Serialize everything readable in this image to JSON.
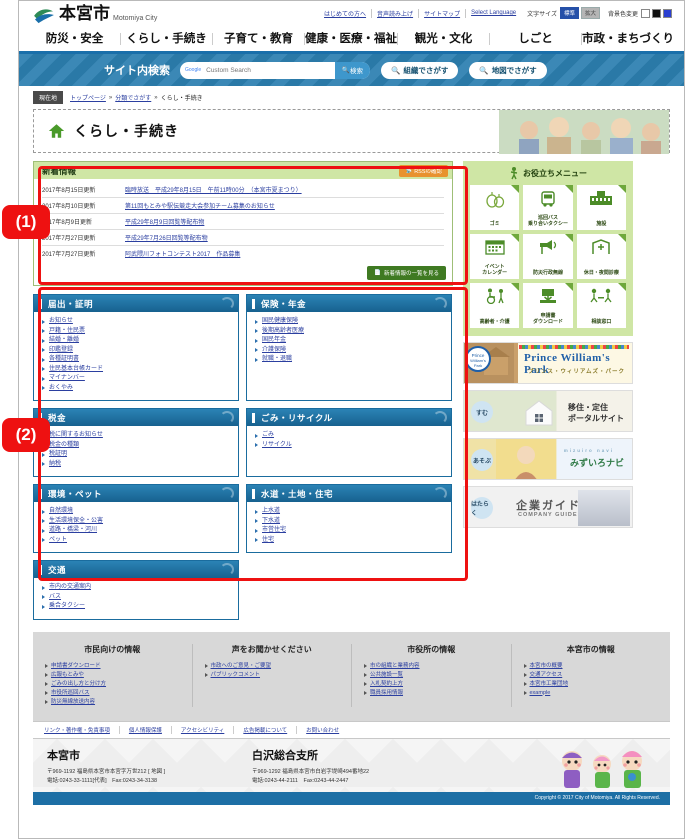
{
  "header": {
    "city_name": "本宮市",
    "city_name_en": "Motomiya City",
    "logo_icon": "swoosh-logo-icon",
    "util_links": [
      "はじめての方へ",
      "音声読み上げ",
      "サイトマップ",
      "Select Language"
    ],
    "text_size_label": "文字サイズ",
    "text_size_options": [
      "標準",
      "拡大"
    ],
    "text_size_selected": "標準",
    "bg_color_label": "背景色変更",
    "bg_color_options": [
      "白",
      "黒",
      "青"
    ],
    "bg_color_selected": "青"
  },
  "gnav": [
    "防災・安全",
    "くらし・手続き",
    "子育て・教育",
    "健康・医療・福祉",
    "観光・文化",
    "しごと",
    "市政・まちづくり"
  ],
  "search": {
    "title": "サイト内検索",
    "engine_badge": "Google",
    "placeholder": "Custom Search",
    "value": "",
    "submit_label": "検索",
    "submit_icon": "search-icon",
    "pills": [
      {
        "label": "組織でさがす",
        "icon": "search-icon"
      },
      {
        "label": "地図でさがす",
        "icon": "search-icon"
      }
    ]
  },
  "breadcrumb": {
    "now_label": "現在地",
    "items": [
      "トップページ",
      "分類でさがす"
    ],
    "current": "くらし・手続き",
    "separator": "»"
  },
  "page_title": {
    "text": "くらし・手続き",
    "icon": "home-icon"
  },
  "news": {
    "heading": "新着情報",
    "rss_label": "RSSの確認",
    "rss_icon": "rss-icon",
    "items": [
      {
        "date": "2017年8月15日更新",
        "title": "臨時放送　平成29年8月15日　午前11時00分　（本宮市夏まつり）"
      },
      {
        "date": "2017年8月10日更新",
        "title": "第11回もとみや駅伝競走大会参加チーム募集のお知らせ"
      },
      {
        "date": "2017年8月9日更新",
        "title": "平成29年8月9日回覧等配布物"
      },
      {
        "date": "2017年7月27日更新",
        "title": "平成29年7月26日回覧等配布物"
      },
      {
        "date": "2017年7月27日更新",
        "title": "阿武隈川フォトコンテスト2017　作品募集"
      }
    ],
    "list_all_label": "新着情報の一覧を見る",
    "list_all_icon": "document-icon"
  },
  "categories": [
    {
      "title": "届出・証明",
      "links": [
        "お知らせ",
        "戸籍・住民票",
        "結婚・離婚",
        "印鑑登録",
        "各種証明書",
        "住民基本台帳カード",
        "マイナンバー",
        "おくやみ"
      ]
    },
    {
      "title": "保険・年金",
      "links": [
        "国民健康保険",
        "後期高齢者医療",
        "国民年金",
        "介護保険",
        "就職・退職"
      ]
    },
    {
      "title": "税金",
      "links": [
        "税に関するお知らせ",
        "税金の種類",
        "税証明",
        "納税"
      ]
    },
    {
      "title": "ごみ・リサイクル",
      "links": [
        "ごみ",
        "リサイクル"
      ]
    },
    {
      "title": "環境・ペット",
      "links": [
        "自然環境",
        "生活環境保全・公害",
        "道路・橋梁・河川",
        "ペット"
      ]
    },
    {
      "title": "水道・土地・住宅",
      "links": [
        "上水道",
        "下水道",
        "市営住宅",
        "住宅"
      ]
    },
    {
      "title": "交通",
      "links": [
        "市内の交通案内",
        "バス",
        "乗合タクシー"
      ]
    }
  ],
  "useful_menu": {
    "title": "お役立ちメニュー",
    "title_icon": "walking-person-icon",
    "tiles": [
      {
        "label": "ゴミ",
        "icon": "garbage-bag-icon"
      },
      {
        "label": "巡回バス\n乗り合いタクシー",
        "icon": "bus-icon"
      },
      {
        "label": "施設",
        "icon": "building-icon"
      },
      {
        "label": "イベント\nカレンダー",
        "icon": "calendar-icon"
      },
      {
        "label": "防災行政無線",
        "icon": "speaker-icon"
      },
      {
        "label": "休日・夜間診療",
        "icon": "hospital-icon"
      },
      {
        "label": "高齢者・介護",
        "icon": "wheelchair-icon"
      },
      {
        "label": "申請書\nダウンロード",
        "icon": "download-icon"
      },
      {
        "label": "相談窓口",
        "icon": "consultation-icon"
      }
    ]
  },
  "banners": [
    {
      "id": "prince-william-park",
      "main": "Prince William's Park",
      "sub": "プリンス・ウィリアムズ・パーク",
      "badge": ""
    },
    {
      "id": "iju-teiju",
      "badge": "すむ",
      "main": "移住・定住\nポータルサイト",
      "sub": ""
    },
    {
      "id": "mizuiro-navi",
      "badge": "あそぶ",
      "main": "みずいろナビ",
      "sub": "mizuiro navi"
    },
    {
      "id": "kigyo-guide",
      "badge": "はたらく",
      "main": "企業ガイド",
      "sub": "COMPANY GUIDE"
    }
  ],
  "footer": {
    "columns": [
      {
        "heading": "市民向けの情報",
        "links": [
          "申請書ダウンロード",
          "広報もとみや",
          "ごみの出し方と分け方",
          "市役所巡回バス",
          "防災無線放送内容"
        ]
      },
      {
        "heading": "声をお聞かせください",
        "links": [
          "市政へのご意見・ご要望",
          "パブリックコメント"
        ]
      },
      {
        "heading": "市役所の情報",
        "links": [
          "市の組織と業務内容",
          "公共施設一覧",
          "入札契約上方",
          "職員採用情報"
        ]
      },
      {
        "heading": "本宮市の情報",
        "links": [
          "本宮市の概要",
          "交通アクセス",
          "本宮市工業団地",
          "example"
        ]
      }
    ],
    "policy_links": [
      "リンク・著作権・免責事項",
      "個人情報保護",
      "アクセシビリティ",
      "広告掲載について",
      "お問い合わせ"
    ],
    "offices": [
      {
        "name": "本宮市",
        "address": "〒969-1192 福島県本宮市本宮字万世212 [ 地図 ]",
        "map_link": "地図",
        "tel": "電話:0243-33-1111[代表]　Fax:0243-34-3138"
      },
      {
        "name": "白沢総合支所",
        "address": "〒969-1292 福島県本宮市白岩字堤崎494番地22",
        "map_link": "",
        "tel": "電話:0243-44-2111　Fax:0243-44-2447"
      }
    ],
    "copyright": "Copyright © 2017 City of Motomiya. All Rights Reserved."
  },
  "annotations": [
    {
      "id": "1",
      "label": "(1)"
    },
    {
      "id": "2",
      "label": "(2)"
    }
  ],
  "colors": {
    "nav_accent": "#1a6faa",
    "search_band": "#2c7fb0",
    "news_green": "#cfe6a5",
    "cat_blue": "#17618f",
    "rss_orange": "#e8922e",
    "annotation_red": "#ee1111"
  }
}
